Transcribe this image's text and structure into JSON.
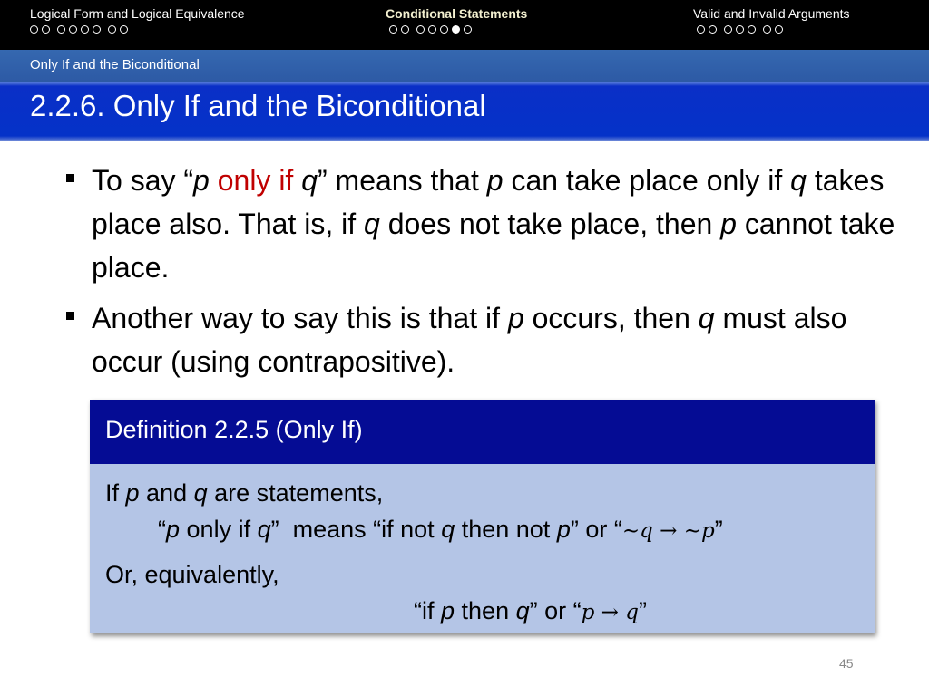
{
  "nav": {
    "sections": [
      {
        "title": "Logical Form and Logical Equivalence",
        "dots": [
          false,
          false,
          false,
          false,
          false,
          false,
          false
        ],
        "active": false
      },
      {
        "title": "Conditional Statements",
        "dots": [
          false,
          false,
          false,
          false,
          false,
          true,
          false
        ],
        "active": true
      },
      {
        "title": "Valid and Invalid Arguments",
        "dots": [
          false,
          false,
          false,
          false,
          false,
          false,
          false
        ],
        "active": false
      }
    ],
    "subsection": "Only If and the Biconditional"
  },
  "slide": {
    "title": "2.2.6. Only If and the Biconditional",
    "bullet1": {
      "t1": "To say “",
      "p1": "p",
      "red": " only if ",
      "q1": "q",
      "t2": "” means that ",
      "p2": "p",
      "t3": " can take place only if ",
      "q2": "q",
      "t4": " takes place also. That is, if ",
      "q3": "q",
      "t5": " does not take place, then ",
      "p3": "p",
      "t6": " cannot take place."
    },
    "bullet2": {
      "t1": "Another way to say this is that if ",
      "p1": "p",
      "t2": " occurs, then ",
      "q1": "q",
      "t3": " must also occur (using contrapositive)."
    },
    "definition": {
      "heading": "Definition 2.2.5 (Only If)",
      "l1a": "If ",
      "l1p": "p",
      "l1b": " and ",
      "l1q": "q",
      "l1c": " are statements,",
      "l2a": "“",
      "l2p": "p",
      "l2b": " only if ",
      "l2q": "q",
      "l2c": "”  means “if not ",
      "l2q2": "q",
      "l2d": " then not ",
      "l2p2": "p",
      "l2e": "” or “",
      "l2math": "∼q → ∼p",
      "l2f": "”",
      "l3": "Or, equivalently,",
      "l4a": "“if ",
      "l4p": "p",
      "l4b": " then ",
      "l4q": "q",
      "l4c": "” or “",
      "l4math": "p → q",
      "l4d": "”"
    },
    "page_number": "45"
  }
}
